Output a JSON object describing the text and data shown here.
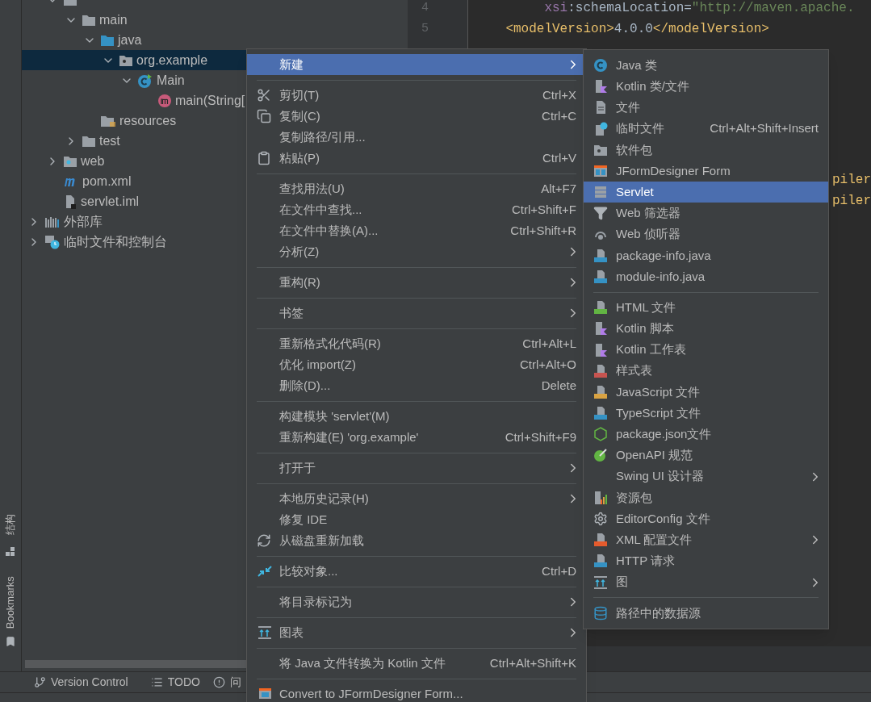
{
  "left_strip": [
    {
      "label": "结构"
    },
    {
      "label": "Bookmarks"
    }
  ],
  "project_tree": {
    "module_children": [
      {
        "kind": "folder",
        "expanded": true,
        "selected": false,
        "children": [
          {
            "label": "main",
            "kind": "folder",
            "expanded": true,
            "selected": false,
            "children": [
              {
                "label": "java",
                "kind": "source-folder",
                "expanded": true,
                "selected": false,
                "children": [
                  {
                    "label": "org.example",
                    "kind": "package",
                    "expanded": true,
                    "selected": true,
                    "children": [
                      {
                        "label": "Main",
                        "kind": "class",
                        "expanded": true,
                        "selected": false,
                        "children": [
                          {
                            "label": "main(String[",
                            "kind": "method",
                            "selected": false
                          }
                        ]
                      }
                    ]
                  }
                ]
              },
              {
                "label": "resources",
                "kind": "resource-folder",
                "selected": false
              }
            ]
          },
          {
            "label": "test",
            "kind": "folder",
            "expanded": false,
            "selected": false
          }
        ]
      },
      {
        "label": "web",
        "kind": "web-folder",
        "expanded": false,
        "selected": false
      },
      {
        "label": "pom.xml",
        "kind": "maven-file",
        "selected": false
      },
      {
        "label": "servlet.iml",
        "kind": "module-file",
        "selected": false
      }
    ],
    "roots": [
      {
        "label": "外部库",
        "kind": "libraries",
        "expanded": false,
        "selected": false
      },
      {
        "label": "临时文件和控制台",
        "kind": "scratches",
        "expanded": false,
        "selected": false
      }
    ]
  },
  "editor": {
    "lines": [
      {
        "number": "4",
        "tokens": [
          {
            "text": "         xsi",
            "kind": "namespace"
          },
          {
            "text": ":schemaLocation=",
            "kind": "plain"
          },
          {
            "text": "\"http://maven.apache.",
            "kind": "string"
          }
        ]
      },
      {
        "number": "5",
        "tokens": [
          {
            "text": "    <modelVersion>",
            "kind": "tag"
          },
          {
            "text": "4.0.0",
            "kind": "plain"
          },
          {
            "text": "</modelVersion>",
            "kind": "tag"
          }
        ]
      }
    ],
    "fragments": [
      "piler",
      "piler"
    ]
  },
  "tool_window_bar": [
    {
      "label": "Version Control"
    },
    {
      "label": "TODO"
    },
    {
      "label": "问"
    }
  ],
  "context_menu": {
    "groups": [
      [
        {
          "label": "新建",
          "selected": true,
          "has_submenu": true
        }
      ],
      [
        {
          "label": "剪切(T)",
          "shortcut": "Ctrl+X",
          "selected": false,
          "has_submenu": false
        },
        {
          "label": "复制(C)",
          "shortcut": "Ctrl+C",
          "selected": false,
          "has_submenu": false
        },
        {
          "label": "复制路径/引用...",
          "selected": false,
          "has_submenu": false
        },
        {
          "label": "粘贴(P)",
          "shortcut": "Ctrl+V",
          "selected": false,
          "has_submenu": false
        }
      ],
      [
        {
          "label": "查找用法(U)",
          "shortcut": "Alt+F7",
          "selected": false,
          "has_submenu": false
        },
        {
          "label": "在文件中查找...",
          "shortcut": "Ctrl+Shift+F",
          "selected": false,
          "has_submenu": false
        },
        {
          "label": "在文件中替换(A)...",
          "shortcut": "Ctrl+Shift+R",
          "selected": false,
          "has_submenu": false
        },
        {
          "label": "分析(Z)",
          "selected": false,
          "has_submenu": true
        }
      ],
      [
        {
          "label": "重构(R)",
          "selected": false,
          "has_submenu": true
        }
      ],
      [
        {
          "label": "书签",
          "selected": false,
          "has_submenu": true
        }
      ],
      [
        {
          "label": "重新格式化代码(R)",
          "shortcut": "Ctrl+Alt+L",
          "selected": false,
          "has_submenu": false
        },
        {
          "label": "优化 import(Z)",
          "shortcut": "Ctrl+Alt+O",
          "selected": false,
          "has_submenu": false
        },
        {
          "label": "删除(D)...",
          "shortcut": "Delete",
          "selected": false,
          "has_submenu": false
        }
      ],
      [
        {
          "label": "构建模块 'servlet'(M)",
          "selected": false,
          "has_submenu": false
        },
        {
          "label": "重新构建(E) 'org.example'",
          "shortcut": "Ctrl+Shift+F9",
          "selected": false,
          "has_submenu": false
        }
      ],
      [
        {
          "label": "打开于",
          "selected": false,
          "has_submenu": true
        }
      ],
      [
        {
          "label": "本地历史记录(H)",
          "selected": false,
          "has_submenu": true
        },
        {
          "label": "修复 IDE",
          "selected": false,
          "has_submenu": false
        },
        {
          "label": "从磁盘重新加载",
          "selected": false,
          "has_submenu": false
        }
      ],
      [
        {
          "label": "比较对象...",
          "shortcut": "Ctrl+D",
          "selected": false,
          "has_submenu": false
        }
      ],
      [
        {
          "label": "将目录标记为",
          "selected": false,
          "has_submenu": true
        }
      ],
      [
        {
          "label": "图表",
          "selected": false,
          "has_submenu": true
        }
      ],
      [
        {
          "label": "将 Java 文件转换为 Kotlin 文件",
          "shortcut": "Ctrl+Alt+Shift+K",
          "selected": false,
          "has_submenu": false
        }
      ],
      [
        {
          "label": "Convert to JFormDesigner Form...",
          "selected": false,
          "has_submenu": false
        }
      ]
    ]
  },
  "submenu": {
    "groups": [
      [
        {
          "label": "Java 类",
          "selected": false,
          "has_submenu": false
        },
        {
          "label": "Kotlin 类/文件",
          "selected": false,
          "has_submenu": false
        },
        {
          "label": "文件",
          "selected": false,
          "has_submenu": false
        },
        {
          "label": "临时文件",
          "shortcut": "Ctrl+Alt+Shift+Insert",
          "selected": false,
          "has_submenu": false
        },
        {
          "label": "软件包",
          "selected": false,
          "has_submenu": false
        },
        {
          "label": "JFormDesigner Form",
          "selected": false,
          "has_submenu": false
        },
        {
          "label": "Servlet",
          "selected": true,
          "has_submenu": false
        },
        {
          "label": "Web 筛选器",
          "selected": false,
          "has_submenu": false
        },
        {
          "label": "Web 侦听器",
          "selected": false,
          "has_submenu": false
        },
        {
          "label": "package-info.java",
          "selected": false,
          "has_submenu": false
        },
        {
          "label": "module-info.java",
          "selected": false,
          "has_submenu": false
        }
      ],
      [
        {
          "label": "HTML 文件",
          "selected": false,
          "has_submenu": false
        },
        {
          "label": "Kotlin 脚本",
          "selected": false,
          "has_submenu": false
        },
        {
          "label": "Kotlin 工作表",
          "selected": false,
          "has_submenu": false
        },
        {
          "label": "样式表",
          "selected": false,
          "has_submenu": false
        },
        {
          "label": "JavaScript 文件",
          "selected": false,
          "has_submenu": false
        },
        {
          "label": "TypeScript 文件",
          "selected": false,
          "has_submenu": false
        },
        {
          "label": "package.json文件",
          "selected": false,
          "has_submenu": false
        },
        {
          "label": "OpenAPI 规范",
          "selected": false,
          "has_submenu": false
        },
        {
          "label": "Swing UI 设计器",
          "selected": false,
          "has_submenu": true
        },
        {
          "label": "资源包",
          "selected": false,
          "has_submenu": false
        },
        {
          "label": "EditorConfig 文件",
          "selected": false,
          "has_submenu": false
        },
        {
          "label": "XML 配置文件",
          "selected": false,
          "has_submenu": true
        },
        {
          "label": "HTTP 请求",
          "selected": false,
          "has_submenu": false
        },
        {
          "label": "图",
          "selected": false,
          "has_submenu": true
        }
      ],
      [
        {
          "label": "路径中的数据源",
          "selected": false,
          "has_submenu": false
        }
      ]
    ]
  }
}
